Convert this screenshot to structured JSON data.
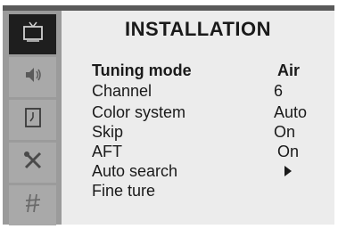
{
  "menu": {
    "title": "INSTALLATION",
    "items": [
      {
        "label": "Tuning mode",
        "value": "Air"
      },
      {
        "label": "Channel",
        "value": "6"
      },
      {
        "label": "Color system",
        "value": "Auto"
      },
      {
        "label": "Skip",
        "value": "On"
      },
      {
        "label": "AFT",
        "value": "On"
      },
      {
        "label": "Auto search",
        "value": ""
      },
      {
        "label": "Fine ture",
        "value": ""
      }
    ]
  },
  "sidebar": {
    "icons": [
      "tv-icon",
      "speaker-icon",
      "clock-icon",
      "tools-icon",
      "antenna-icon"
    ],
    "active_index": 0
  }
}
